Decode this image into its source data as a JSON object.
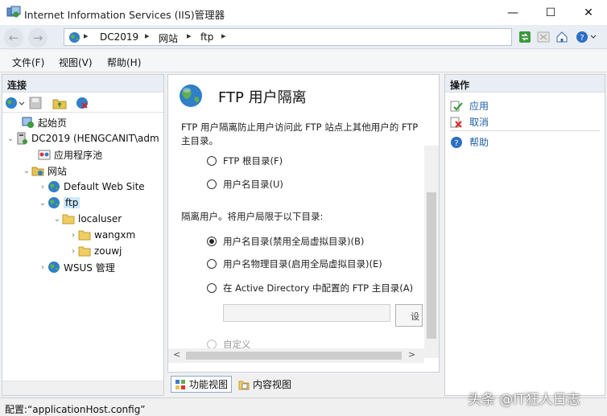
{
  "window": {
    "title": "Internet Information Services (IIS)管理器",
    "min_glyph": "—",
    "max_glyph": "☐",
    "close_glyph": "✕"
  },
  "address": {
    "back_glyph": "←",
    "forward_glyph": "→",
    "crumbs": [
      "DC2019",
      "网站",
      "ftp"
    ],
    "sep": "▸",
    "trail_sep": "▸"
  },
  "menu": [
    "文件(F)",
    "视图(V)",
    "帮助(H)"
  ],
  "left": {
    "header": "连接",
    "tree": [
      {
        "label": "起始页",
        "arrow": "",
        "icon": "start-page-icon",
        "level": 0
      },
      {
        "label": "DC2019 (HENGCANIT\\adm",
        "arrow": "⌄",
        "icon": "server-icon",
        "level": 0
      },
      {
        "label": "应用程序池",
        "arrow": "",
        "icon": "app-pool-icon",
        "level": 1
      },
      {
        "label": "网站",
        "arrow": "⌄",
        "icon": "sites-folder-icon",
        "level": 1
      },
      {
        "label": "Default Web Site",
        "arrow": "›",
        "icon": "globe-icon",
        "level": 2
      },
      {
        "label": "ftp",
        "arrow": "⌄",
        "icon": "globe-icon",
        "level": 2,
        "selected": true
      },
      {
        "label": "localuser",
        "arrow": "⌄",
        "icon": "folder-icon",
        "level": 3
      },
      {
        "label": "wangxm",
        "arrow": "›",
        "icon": "folder-icon",
        "level": 4
      },
      {
        "label": "zouwj",
        "arrow": "›",
        "icon": "folder-icon",
        "level": 4
      },
      {
        "label": "WSUS 管理",
        "arrow": "›",
        "icon": "globe-icon",
        "level": 2
      }
    ]
  },
  "center": {
    "title": "FTP 用户隔离",
    "description": "FTP 用户隔离防止用户访问此 FTP 站点上其他用户的 FTP 主目录。",
    "no_isolate_options": [
      {
        "label": "FTP 根目录(F)",
        "checked": false
      },
      {
        "label": "用户名目录(U)",
        "checked": false
      }
    ],
    "isolate_label": "隔离用户。将用户局限于以下目录:",
    "isolate_options": [
      {
        "label": "用户名目录(禁用全局虚拟目录)(B)",
        "checked": true
      },
      {
        "label": "用户名物理目录(启用全局虚拟目录)(E)",
        "checked": false
      },
      {
        "label": "在 Active Directory 中配置的 FTP 主目录(A)",
        "checked": false
      }
    ],
    "ad_input_value": "",
    "ad_set_button": "设",
    "custom_option": "自定义",
    "scroll_left": "<",
    "scroll_right": ">"
  },
  "tabs": {
    "features": "功能视图",
    "content": "内容视图"
  },
  "actions": {
    "header": "操作",
    "items": [
      {
        "label": "应用",
        "icon": "apply-icon"
      },
      {
        "label": "取消",
        "icon": "cancel-icon"
      }
    ],
    "help": "帮助"
  },
  "status": "配置:“applicationHost.config”",
  "watermark": "头条 @IT狂人日志",
  "colors": {
    "accent_link": "#1f5fa7",
    "selection": "#cce8ff",
    "panel_header": "#e9eef5"
  }
}
